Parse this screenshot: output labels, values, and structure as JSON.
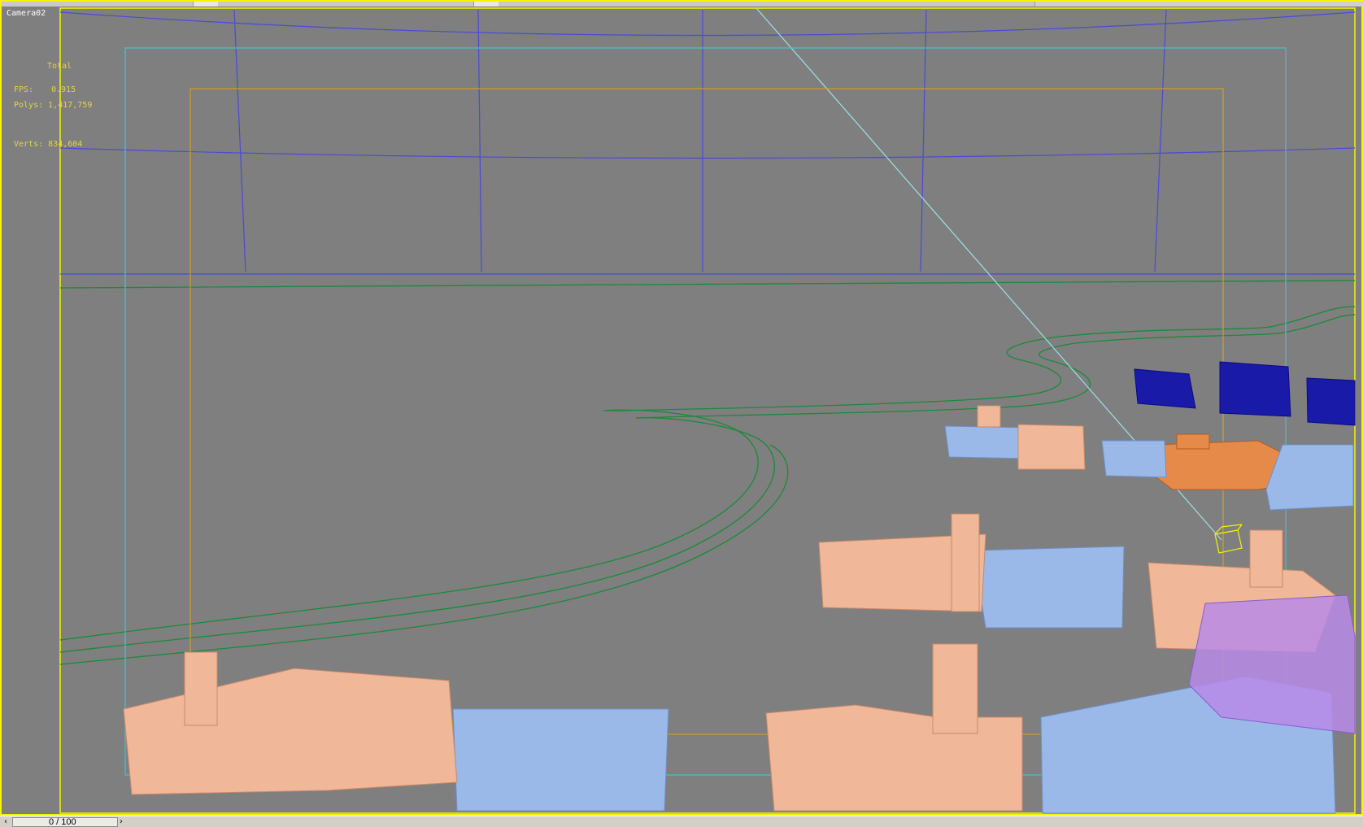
{
  "viewport": {
    "label": "Camera02",
    "stats": {
      "header": "Total",
      "polys_label": "Polys:",
      "polys_value": "1,417,759",
      "verts_label": "Verts:",
      "verts_value": "834,604",
      "fps_label": "FPS:",
      "fps_value": "0.915"
    },
    "colors": {
      "background": "#7f7f7f",
      "active_border": "#f6f400",
      "safe_frame_outer": "#f6f400",
      "safe_frame_action": "#3ec8c8",
      "safe_frame_title": "#d89a20",
      "grid_lines": "#4a4ad8",
      "road_lines": "#1a8a3a",
      "building_peach": "#f0b898",
      "building_blue": "#9ab8e8",
      "building_dark_blue": "#1a1aa8",
      "building_orange": "#e68a4a",
      "building_purple": "#b88ae8",
      "camera_target": "#f6f400"
    }
  },
  "timeline": {
    "frame_display": "0 / 100",
    "prev_icon": "chevron-left-icon",
    "next_icon": "chevron-right-icon"
  }
}
